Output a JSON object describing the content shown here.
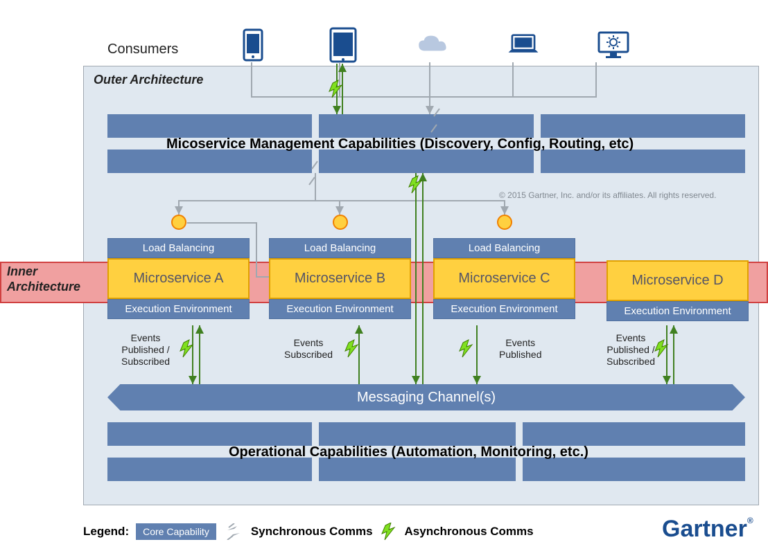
{
  "consumers_label": "Consumers",
  "outer_arch_label": "Outer Architecture",
  "inner_arch_label": "Inner\nArchitecture",
  "mgmt_label": "Micoservice Management Capabilities (Discovery, Config, Routing, etc)",
  "copyright": "© 2015 Gartner, Inc. and/or its affiliates. All rights reserved.",
  "microservices": [
    {
      "lb": "Load Balancing",
      "name": "Microservice A",
      "ee": "Execution Environment",
      "events": "Events\nPublished /\nSubscribed"
    },
    {
      "lb": "Load Balancing",
      "name": "Microservice B",
      "ee": "Execution Environment",
      "events": "Events\nSubscribed"
    },
    {
      "lb": "Load Balancing",
      "name": "Microservice C",
      "ee": "Execution Environment",
      "events": "Events\nPublished"
    },
    {
      "lb": "",
      "name": "Microservice D",
      "ee": "Execution Environment",
      "events": "Events\nPublished /\nSubscribed"
    }
  ],
  "msg_channel": "Messaging Channel(s)",
  "ops_label": "Operational Capabilities (Automation, Monitoring, etc.)",
  "legend": {
    "label": "Legend:",
    "core": "Core Capability",
    "sync": "Synchronous Comms",
    "async": "Asynchronous Comms"
  },
  "gartner": "Gartner"
}
